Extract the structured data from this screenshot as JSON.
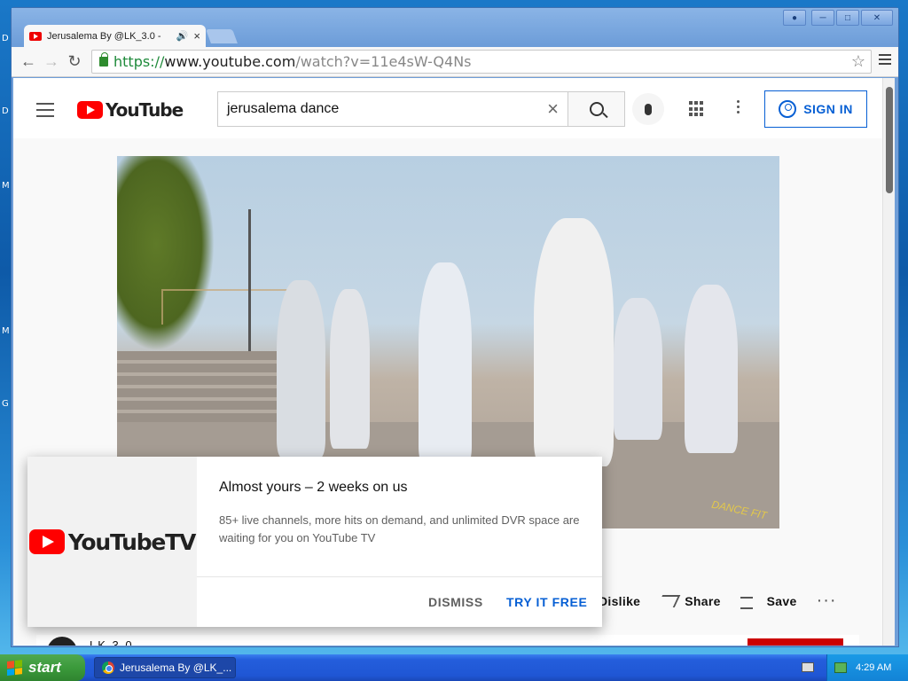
{
  "desktop": {
    "letters": [
      "D",
      "M",
      "M",
      "G"
    ]
  },
  "browser": {
    "tab_title": "Jerusalema By @LK_3.0 -",
    "tab_audio_icon": "speaker-icon",
    "tab_close": "×",
    "url": {
      "scheme": "https://",
      "host": "www.youtube.com",
      "path": "/watch?v=11e4sW-Q4Ns"
    }
  },
  "youtube": {
    "logo_text": "YouTube",
    "search_value": "jerusalema dance",
    "clear_glyph": "×",
    "sign_in_label": "SIGN IN",
    "video_watermark": "DANCE FIT",
    "actions": {
      "dislike": "Dislike",
      "share": "Share",
      "save": "Save",
      "more": "···"
    },
    "channel_name": "LK 3.0"
  },
  "promo": {
    "logo_text": "YouTubeTV",
    "title": "Almost yours – 2 weeks on us",
    "body": "85+ live channels, more hits on demand, and unlimited DVR space are waiting for you on YouTube TV",
    "dismiss_label": "DISMISS",
    "try_label": "TRY IT FREE"
  },
  "taskbar": {
    "start_label": "start",
    "task_label": "Jerusalema By @LK_...",
    "clock": "4:29 AM"
  },
  "colors": {
    "yt_red": "#ff0000",
    "link_blue": "#065fd4",
    "xp_blue": "#245edc",
    "xp_green": "#3b9a3b"
  }
}
